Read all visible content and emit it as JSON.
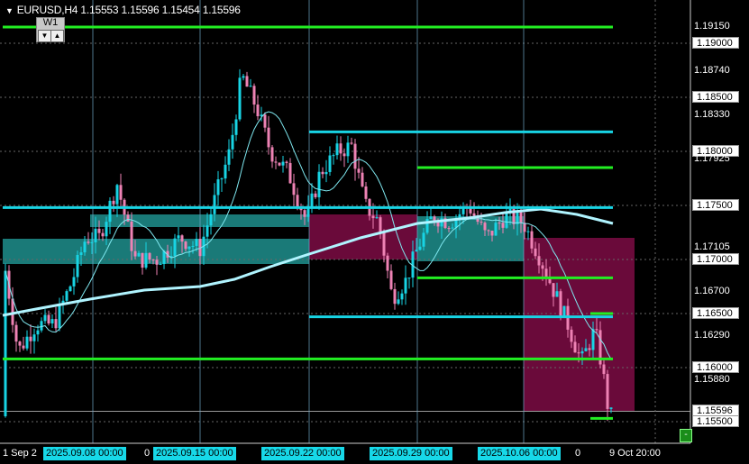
{
  "header": {
    "symbol_tf": "EURUSD,H4",
    "o": "1.15553",
    "h": "1.15596",
    "l": "1.15454",
    "c": "1.15596"
  },
  "wbox": {
    "label": "W1",
    "down": "▼",
    "up": "▲"
  },
  "price_labels": [
    {
      "text": "1.19150",
      "box": false
    },
    {
      "text": "1.19000",
      "box": true
    },
    {
      "text": "1.18740",
      "box": false
    },
    {
      "text": "1.18500",
      "box": true
    },
    {
      "text": "1.18330",
      "box": false
    },
    {
      "text": "1.18000",
      "box": true
    },
    {
      "text": "1.17925",
      "box": false
    },
    {
      "text": "1.17500",
      "box": true
    },
    {
      "text": "1.17105",
      "box": false
    },
    {
      "text": "1.17000",
      "box": true
    },
    {
      "text": "1.16700",
      "box": false
    },
    {
      "text": "1.16500",
      "box": true
    },
    {
      "text": "1.16290",
      "box": false
    },
    {
      "text": "1.16000",
      "box": true
    },
    {
      "text": "1.15880",
      "box": false
    },
    {
      "text": "1.15596",
      "box": true
    },
    {
      "text": "1.15500",
      "box": true
    }
  ],
  "time_labels": [
    {
      "text": "1 Sep 2",
      "hl": false
    },
    {
      "text": "2025.09.08 00:00",
      "hl": true
    },
    {
      "text": "0",
      "hl": false
    },
    {
      "text": "2025.09.15 00:00",
      "hl": true
    },
    {
      "text": "2025.09.22 00:00",
      "hl": true
    },
    {
      "text": "2025.09.29 00:00",
      "hl": true
    },
    {
      "text": "2025.10.06 00:00",
      "hl": true
    },
    {
      "text": "0",
      "hl": false
    },
    {
      "text": "9 Oct 20:00",
      "hl": false
    }
  ],
  "mini_button": "-",
  "colors": {
    "bull": "#18d4e4",
    "bear": "#ee82b4",
    "level_green": "#22ee22",
    "level_cyan": "#18d4e4",
    "zone_teal": "#1a7a78",
    "zone_maroon": "#6a0a3a",
    "ma_fast": "#7fe8f0",
    "ma_slow": "#b0f4ff",
    "grid": "#666"
  }
}
